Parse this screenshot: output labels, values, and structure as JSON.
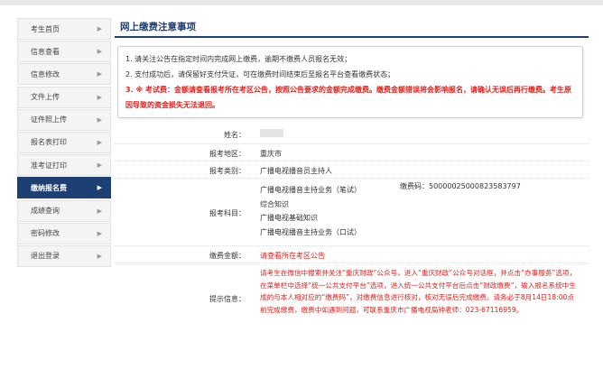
{
  "sidebar": {
    "items": [
      {
        "label": "考生首页",
        "active": false
      },
      {
        "label": "信息查看",
        "active": false
      },
      {
        "label": "信息修改",
        "active": false
      },
      {
        "label": "文件上传",
        "active": false
      },
      {
        "label": "证件照上传",
        "active": false
      },
      {
        "label": "报名表打印",
        "active": false
      },
      {
        "label": "准考证打印",
        "active": false
      },
      {
        "label": "缴纳报名费",
        "active": true
      },
      {
        "label": "成绩查询",
        "active": false
      },
      {
        "label": "密码修改",
        "active": false
      },
      {
        "label": "退出登录",
        "active": false
      }
    ],
    "arrow_icon": "triangle-right-icon"
  },
  "main": {
    "title": "网上缴费注意事项",
    "notice": {
      "line1": "1. 请关注公告在指定时间内完成网上缴费，逾期不缴费人员报名无效；",
      "line2": "2. 支付成功后，请保留好支付凭证，可在缴费时间结束后至报名平台查看缴费状态；",
      "line3": "3. ※ 考试费：金额请查看报考所在考区公告，按照公告要求的金额完成缴费。缴费金额错误将会影响报名，请确认无误后再行缴费。考生原因导致的资金损失无法退回。"
    }
  },
  "form": {
    "name_label": "姓名：",
    "region_label": "报考地区：",
    "region_value": "重庆市",
    "category_label": "报考类别：",
    "category_value": "广播电视播音员主持人",
    "subjects_label": "报考科目：",
    "subjects": [
      "广播电视播音主持业务（笔试）",
      "综合知识",
      "广播电视基础知识",
      "广播电视播音主持业务（口试）"
    ],
    "payment_code_label": "缴费码：",
    "payment_code": "50000025000823583797",
    "fee_label": "缴费金额：",
    "fee_value": "请查看所在考区公告",
    "hint_label": "提示信息：",
    "hint_text": "请考生在微信中搜索并关注“重庆财政”公众号，进入“重庆财政”公众号对话框，并点击“办事服务”选项，在菜单栏中选择“统一公共支付平台”选项，进入统一公共支付平台后点击“财政缴费”，输入报名系统中生成的与本人相对应的“缴费码”，对缴费信息进行核对，核对无误后完成缴费。请务必于8月14日18:00点前完成缴费，缴费中如遇到问题，可联系重庆市广播电视局钟老师：023-67116959。"
  },
  "colors": {
    "accent": "#1e3f73",
    "warning": "#e0211c"
  }
}
